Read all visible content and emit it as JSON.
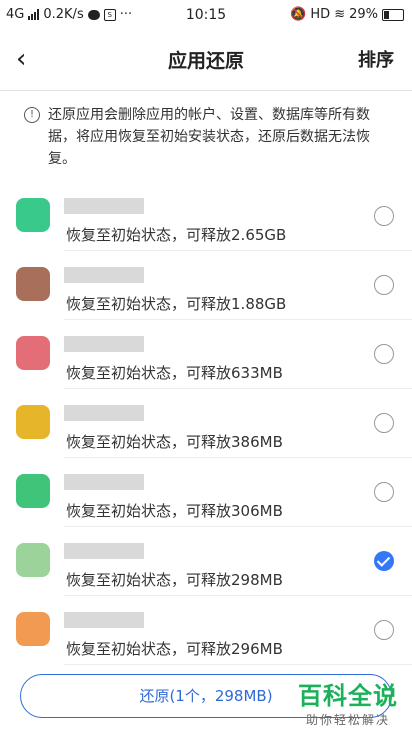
{
  "status_bar": {
    "network": "4G",
    "speed": "0.2K/s",
    "time": "10:15",
    "hd": "HD",
    "battery": "29%"
  },
  "header": {
    "title": "应用还原",
    "sort_label": "排序"
  },
  "notice": "还原应用会删除应用的帐户、设置、数据库等所有数据，将应用恢复至初始安装状态，还原后数据无法恢复。",
  "apps": [
    {
      "subtitle": "恢复至初始状态，可释放2.65GB",
      "checked": false,
      "color": "#39c98a"
    },
    {
      "subtitle": "恢复至初始状态，可释放1.88GB",
      "checked": false,
      "color": "#a8705a"
    },
    {
      "subtitle": "恢复至初始状态，可释放633MB",
      "checked": false,
      "color": "#e46e78"
    },
    {
      "subtitle": "恢复至初始状态，可释放386MB",
      "checked": false,
      "color": "#e6b52a"
    },
    {
      "subtitle": "恢复至初始状态，可释放306MB",
      "checked": false,
      "color": "#3fc47a"
    },
    {
      "subtitle": "恢复至初始状态，可释放298MB",
      "checked": true,
      "color": "#9bd39a"
    },
    {
      "subtitle": "恢复至初始状态，可释放296MB",
      "checked": false,
      "color": "#f29a52"
    }
  ],
  "restore_button_label": "还原(1个，298MB)",
  "watermark": {
    "title": "百科全说",
    "subtitle": "助你轻松解决"
  }
}
